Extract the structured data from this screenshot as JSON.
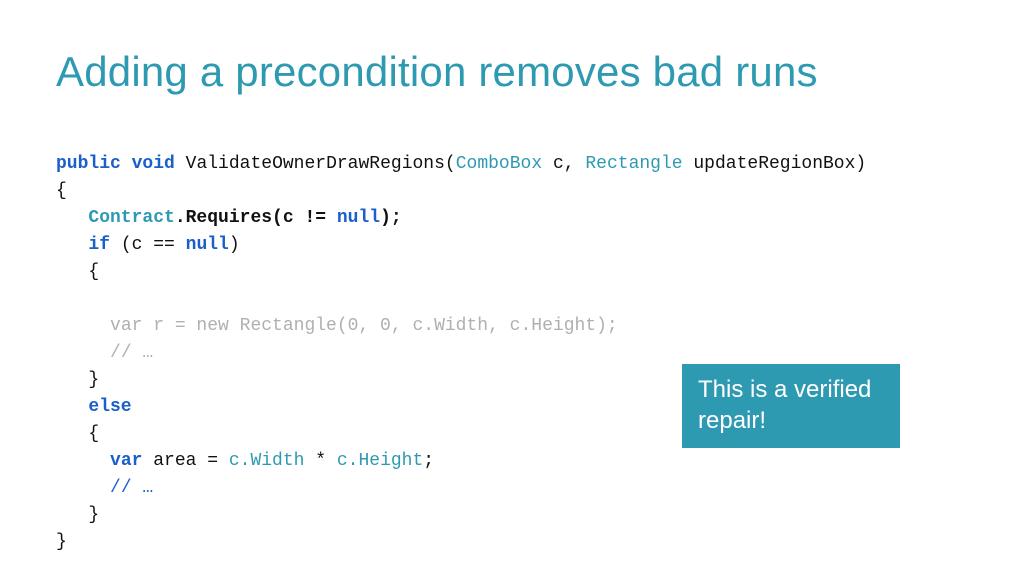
{
  "colors": {
    "accent": "#2e9ab2",
    "keyword_blue": "#1a5fca",
    "type_teal": "#2e9ab2",
    "dim": "#b0b0b0",
    "text": "#111111",
    "callout_bg": "#2e9ab2",
    "callout_text": "#ffffff"
  },
  "title": "Adding a precondition removes bad runs",
  "code": {
    "kw_public": "public",
    "kw_void": "void",
    "method": "ValidateOwnerDrawRegions",
    "lparen": "(",
    "type_combobox": "ComboBox",
    "param_c": " c, ",
    "type_rectangle": "Rectangle",
    "param_update": " updateRegionBox)",
    "open_brace": "{",
    "contract": "Contract",
    "requires_call": ".Requires(c != ",
    "kw_null1": "null",
    "requires_close": ");",
    "kw_if": "if",
    "if_cond_open": " (c == ",
    "kw_null2": "null",
    "if_cond_close": ")",
    "open_brace2": "{",
    "dim_line1": "var r = new Rectangle(0, 0, c.Width, c.Height);",
    "dim_line2": "// …",
    "close_brace2": "}",
    "kw_else": "else",
    "open_brace3": "{",
    "kw_var": "var",
    "area": " area = ",
    "c_width": "c.Width",
    "times": " * ",
    "c_height": "c.Height",
    "semi": ";",
    "comment": "// …",
    "close_brace3": "}",
    "close_brace1": "}"
  },
  "callout": "This is a verified repair!"
}
